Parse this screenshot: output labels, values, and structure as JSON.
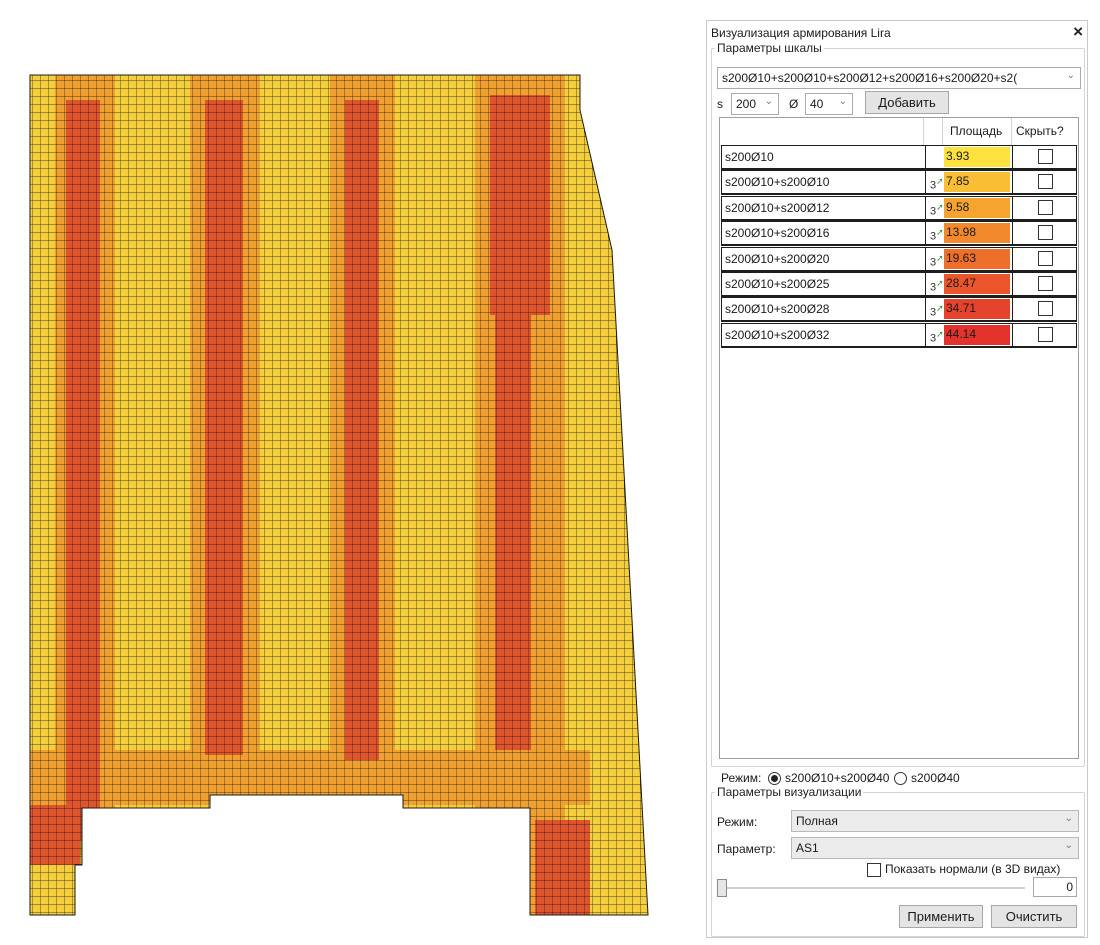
{
  "viewport": {
    "colors": {
      "low": "#f5ce3c",
      "mid": "#f0a02e",
      "high": "#e0542d",
      "grid": "#1a1a1a"
    }
  },
  "panel": {
    "title": "Визуализация армирования Lira",
    "close_icon": "×",
    "scale_group": {
      "legend": "Параметры шкалы",
      "preset_combo": "s200Ø10+s200Ø10+s200Ø12+s200Ø16+s200Ø20+s2(",
      "s_label": "s",
      "s_value": "200",
      "d_label": "Ø",
      "d_value": "40",
      "add_button": "Добавить"
    },
    "table": {
      "headers": {
        "name": "",
        "edit": "",
        "area": "Площадь",
        "hide": "Скрыть?"
      },
      "rows": [
        {
          "name": "s200Ø10",
          "area": "3.93",
          "color": "#fce23f",
          "editable": false,
          "hidden": false
        },
        {
          "name": "s200Ø10+s200Ø10",
          "area": "7.85",
          "color": "#f9be33",
          "editable": true,
          "hidden": false
        },
        {
          "name": "s200Ø10+s200Ø12",
          "area": "9.58",
          "color": "#f6a430",
          "editable": true,
          "hidden": false
        },
        {
          "name": "s200Ø10+s200Ø16",
          "area": "13.98",
          "color": "#f28a2d",
          "editable": true,
          "hidden": false
        },
        {
          "name": "s200Ø10+s200Ø20",
          "area": "19.63",
          "color": "#ee6e2c",
          "editable": true,
          "hidden": false
        },
        {
          "name": "s200Ø10+s200Ø25",
          "area": "28.47",
          "color": "#ea552c",
          "editable": true,
          "hidden": false
        },
        {
          "name": "s200Ø10+s200Ø28",
          "area": "34.71",
          "color": "#e6432c",
          "editable": true,
          "hidden": false
        },
        {
          "name": "s200Ø10+s200Ø32",
          "area": "44.14",
          "color": "#e3332c",
          "editable": true,
          "hidden": false
        }
      ]
    },
    "mode_row": {
      "label": "Режим:",
      "option1": "s200Ø10+s200Ø40",
      "option2": "s200Ø40",
      "selected": "option1"
    },
    "vis_group": {
      "legend": "Параметры визуализации",
      "mode_label": "Режим:",
      "mode_value": "Полная",
      "param_label": "Параметр:",
      "param_value": "AS1",
      "normals_label": "Показать нормали (в 3D видах)",
      "normals_checked": false,
      "slider_value": "0",
      "apply_button": "Применить",
      "clear_button": "Очистить"
    }
  }
}
